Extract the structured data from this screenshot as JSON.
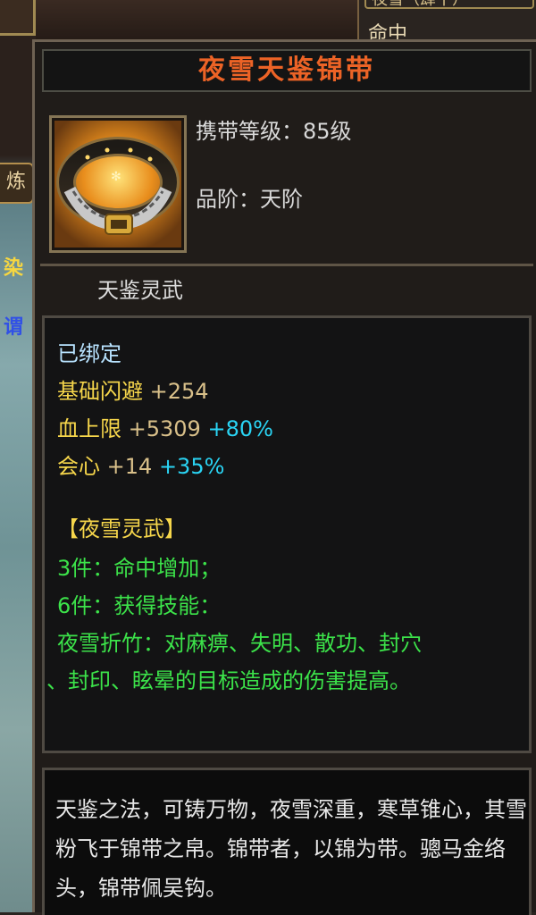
{
  "background": {
    "left_panel": {
      "lian_char": "炼",
      "ran_char": "染",
      "yu_char": "谓"
    },
    "right_panel": {
      "tab_label": "夜雪（肆十）",
      "row_label": "命中"
    }
  },
  "item": {
    "name": "夜雪天鉴锦带",
    "icon": "golden-belt-icon",
    "carry_level": "携带等级：85级",
    "grade": "品阶：天阶",
    "set_label": "天鉴灵武",
    "bound": "已绑定",
    "base_dodge": {
      "label": "基础闪避",
      "value": "+254"
    },
    "hp_max": {
      "label": "血上限",
      "value": "+5309",
      "percent": "+80%"
    },
    "crit": {
      "label": "会心",
      "value": "+14",
      "percent": "+35%"
    },
    "set_title": "【夜雪灵武】",
    "set_3": "3件：命中增加；",
    "set_6": "6件：获得技能：",
    "skill_line1": "夜雪折竹：对麻痹、失明、散功、封穴",
    "skill_line2": "、封印、眩晕的目标造成的伤害提高。",
    "description": "天鉴之法，可铸万物，夜雪深重，寒草锥心，其雪粉飞于锦带之帛。锦带者，以锦为带。骢马金络头，锦带佩吴钩。"
  },
  "colors": {
    "title": "#ec6326",
    "bound": "#b8e3ff",
    "stat_label": "#f6d64b",
    "stat_value": "#d9c08a",
    "percent": "#2ad4f4",
    "set_green": "#3ce34a"
  }
}
